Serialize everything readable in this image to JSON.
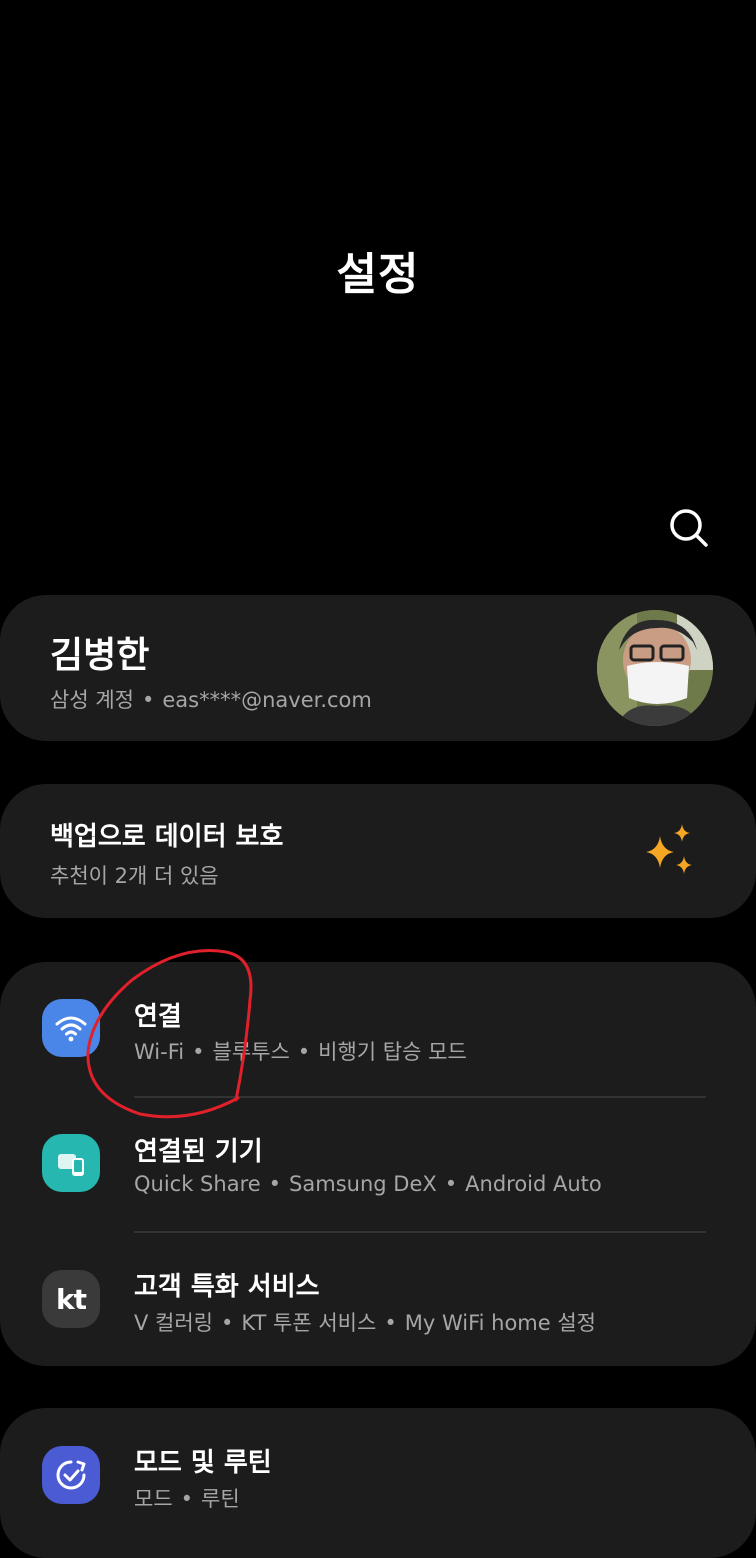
{
  "header": {
    "title": "설정"
  },
  "profile": {
    "name": "김병한",
    "account_label": "삼성 계정",
    "email": "eas****@naver.com"
  },
  "suggestion": {
    "title": "백업으로 데이터 보호",
    "subtitle": "추천이 2개 더 있음",
    "icon": "sparkle-icon",
    "icon_color": "#f5a623"
  },
  "settings_group": [
    {
      "title": "연결",
      "subs": [
        "Wi-Fi",
        "블루투스",
        "비행기 탑승 모드"
      ],
      "icon": "wifi-icon",
      "icon_color": "#4a86e8"
    },
    {
      "title": "연결된 기기",
      "subs": [
        "Quick Share",
        "Samsung DeX",
        "Android Auto"
      ],
      "icon": "devices-icon",
      "icon_color": "#26b8b0"
    },
    {
      "title": "고객 특화 서비스",
      "subs": [
        "V 컬러링",
        "KT 투폰 서비스",
        "My WiFi home 설정"
      ],
      "icon": "kt-icon",
      "icon_color": "#3a3a3a",
      "icon_text": "kt"
    }
  ],
  "routine": {
    "title": "모드 및 루틴",
    "subs": [
      "모드",
      "루틴"
    ],
    "icon": "routine-icon",
    "icon_color": "#4a5bd4"
  },
  "annotation_color": "#e0202a"
}
